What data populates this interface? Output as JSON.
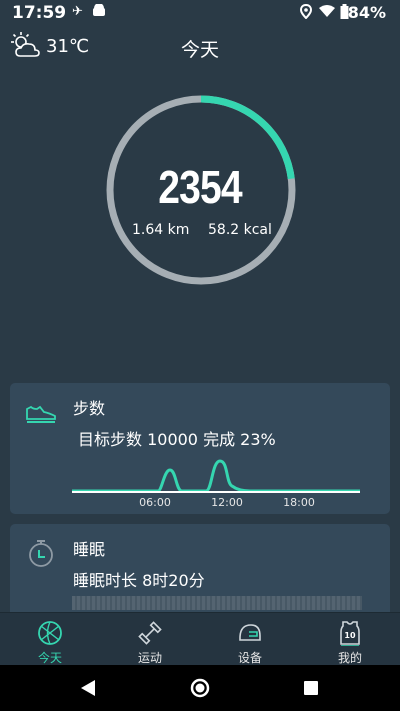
{
  "status": {
    "time": "17:59",
    "battery": "84%"
  },
  "header": {
    "temperature": "31℃",
    "title": "今天"
  },
  "summary": {
    "steps": "2354",
    "distance": "1.64 km",
    "calories": "58.2 kcal",
    "goal_progress": 0.23
  },
  "steps_card": {
    "title": "步数",
    "subtitle": "目标步数 10000 完成 23%",
    "chart_data": {
      "type": "line",
      "x_ticks": [
        "06:00",
        "12:00",
        "18:00"
      ]
    }
  },
  "sleep_card": {
    "title": "睡眠",
    "subtitle": "睡眠时长 8时20分"
  },
  "tabs": [
    {
      "label": "今天",
      "icon": "basketball-icon"
    },
    {
      "label": "运动",
      "icon": "dumbbell-icon"
    },
    {
      "label": "设备",
      "icon": "helmet-icon"
    },
    {
      "label": "我的",
      "icon": "jersey-icon"
    }
  ],
  "jersey_number": "10",
  "colors": {
    "accent": "#35d6b0",
    "background": "#2a3a46",
    "card": "#34495a"
  }
}
